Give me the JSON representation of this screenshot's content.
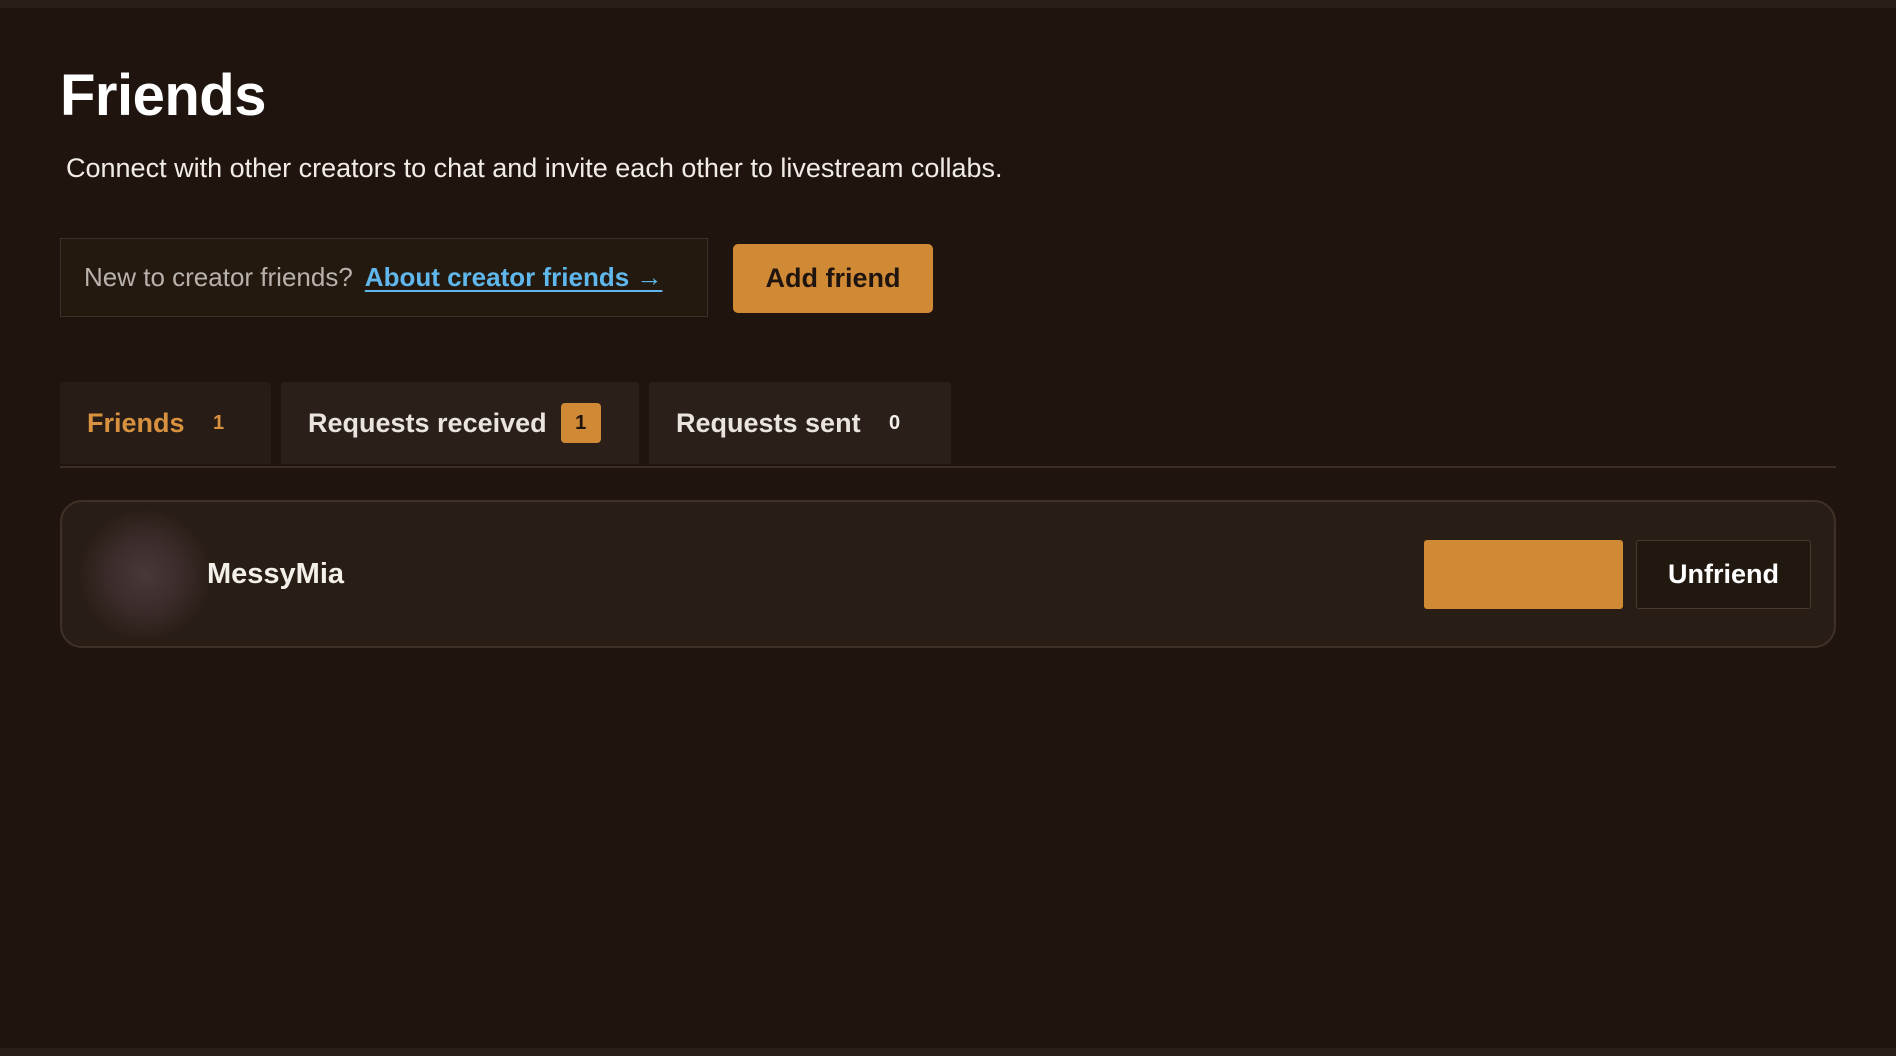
{
  "header": {
    "title": "Friends",
    "subtitle": "Connect with other creators to chat and invite each other to livestream collabs."
  },
  "info": {
    "text": "New to creator friends?",
    "link_label": "About creator friends →"
  },
  "actions": {
    "add_friend_label": "Add friend"
  },
  "tabs": [
    {
      "label": "Friends",
      "count": "1",
      "active": true
    },
    {
      "label": "Requests received",
      "count": "1",
      "active": false
    },
    {
      "label": "Requests sent",
      "count": "0",
      "active": false
    }
  ],
  "friends": [
    {
      "name": "MessyMia",
      "unfriend_label": "Unfriend"
    }
  ],
  "colors": {
    "background": "#1f150e",
    "accent": "#d08a35",
    "link": "#5fb7ec"
  }
}
